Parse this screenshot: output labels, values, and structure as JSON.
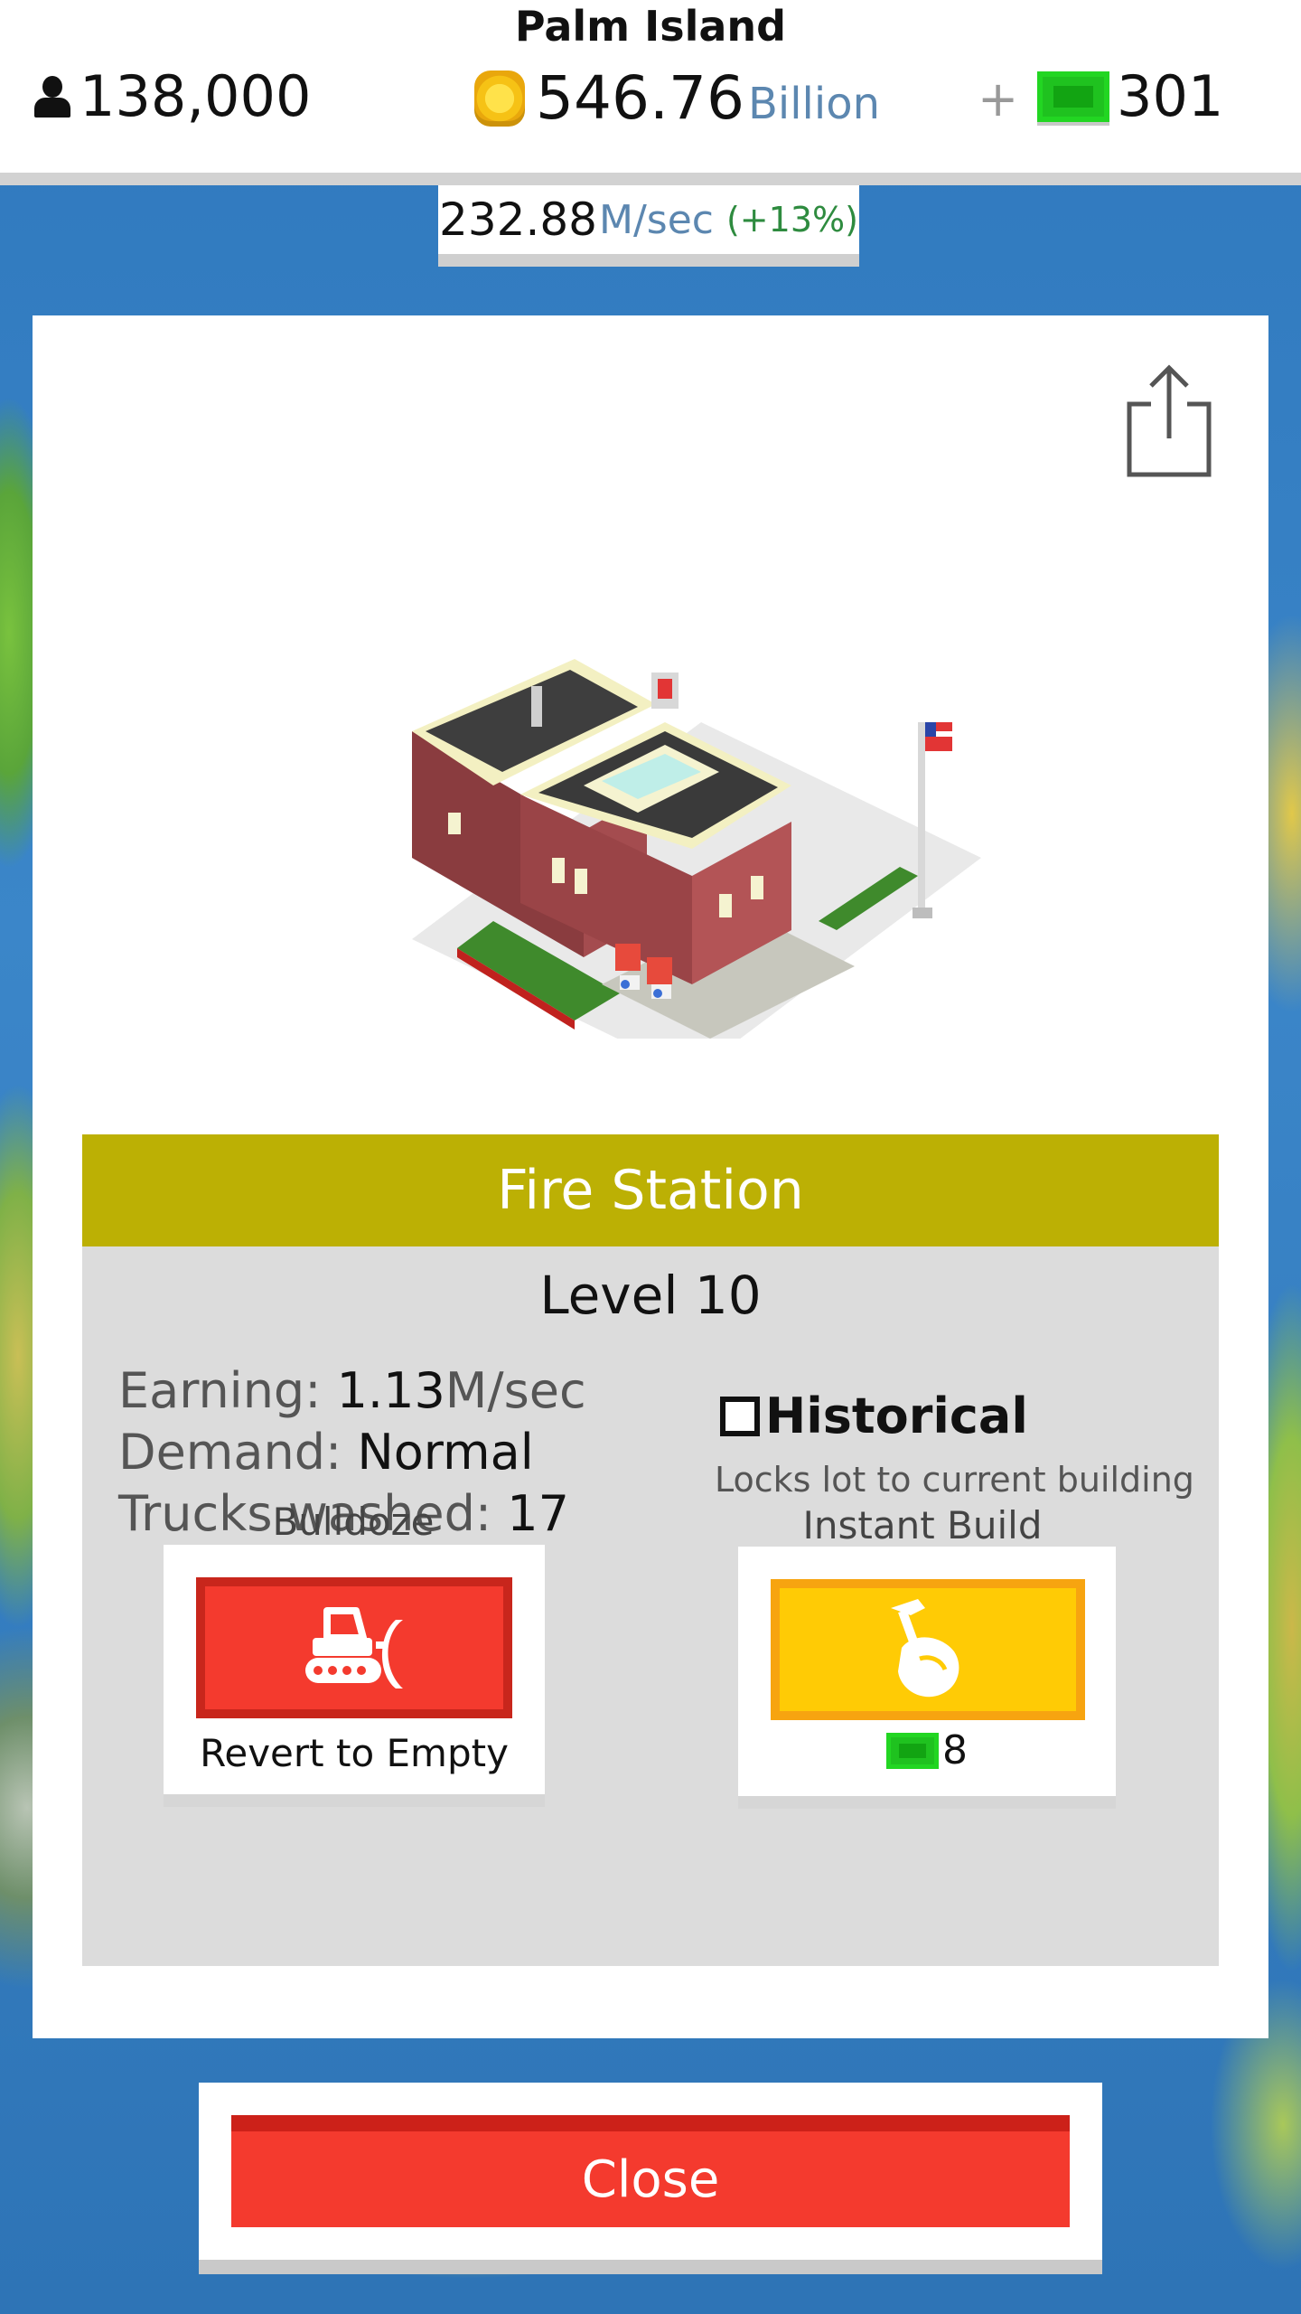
{
  "hud": {
    "island_name": "Palm Island",
    "population": "138,000",
    "money_value": "546.76",
    "money_unit": "Billion",
    "plus_label": "+",
    "cash": "301",
    "rate_value": "232.88",
    "rate_unit": "M/sec",
    "rate_bonus": "(+13%)"
  },
  "building": {
    "name": "Fire Station",
    "level": "Level 10",
    "stats": {
      "earning_label": "Earning: ",
      "earning_value": "1.13",
      "earning_unit": "M/sec",
      "demand_label": "Demand: ",
      "demand_value": "Normal",
      "trucks_label": "Trucks washed: ",
      "trucks_value": "17"
    },
    "historical": {
      "label": "Historical",
      "description": "Locks lot to current building",
      "checked": false
    }
  },
  "actions": {
    "bulldoze": {
      "title": "Bulldoze",
      "caption": "Revert to Empty",
      "icon": "bulldozer-icon"
    },
    "instant_build": {
      "title": "Instant Build",
      "cost": "8",
      "icon": "hammer-hand-icon"
    }
  },
  "close_label": "Close",
  "colors": {
    "title_bar": "#bcb004",
    "danger": "#f43a2e",
    "gold": "#ffcb05",
    "cash_green": "#1fc21f",
    "ocean": "#2f78bd"
  }
}
